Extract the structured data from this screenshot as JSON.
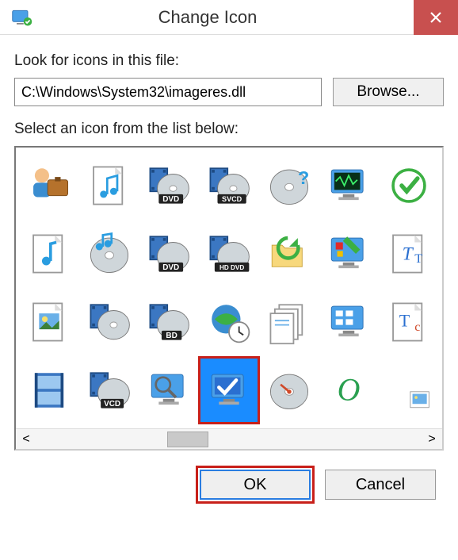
{
  "titlebar": {
    "title": "Change Icon"
  },
  "labels": {
    "look_for": "Look for icons in this file:",
    "select": "Select an icon from the list below:"
  },
  "path_field": {
    "value": "C:\\Windows\\System32\\imageres.dll"
  },
  "buttons": {
    "browse": "Browse...",
    "ok": "OK",
    "cancel": "Cancel"
  },
  "scrollbar": {
    "left": "<",
    "right": ">"
  },
  "icons": [
    {
      "name": "user-briefcase-icon",
      "selected": false
    },
    {
      "name": "page-music-icon",
      "selected": false
    },
    {
      "name": "disc-dvd-film-icon",
      "selected": false
    },
    {
      "name": "disc-svcd-film-icon",
      "selected": false
    },
    {
      "name": "disc-question-icon",
      "selected": false
    },
    {
      "name": "monitor-waveform-icon",
      "selected": false
    },
    {
      "name": "checkmark-green-icon",
      "selected": false
    },
    {
      "name": "page-note-icon",
      "selected": false
    },
    {
      "name": "disc-music-icon",
      "selected": false
    },
    {
      "name": "disc-dvd-film2-icon",
      "selected": false
    },
    {
      "name": "disc-hddvd-icon",
      "selected": false
    },
    {
      "name": "folder-refresh-icon",
      "selected": false
    },
    {
      "name": "monitor-paint-icon",
      "selected": false
    },
    {
      "name": "page-tt-icon",
      "selected": false
    },
    {
      "name": "page-photo-icon",
      "selected": false
    },
    {
      "name": "disc-film-icon",
      "selected": false
    },
    {
      "name": "disc-bd-film-icon",
      "selected": false
    },
    {
      "name": "globe-clock-icon",
      "selected": false
    },
    {
      "name": "documents-stack-icon",
      "selected": false
    },
    {
      "name": "monitor-apps-icon",
      "selected": false
    },
    {
      "name": "page-tc-icon",
      "selected": false
    },
    {
      "name": "film-strip-icon",
      "selected": false
    },
    {
      "name": "disc-vcd-icon",
      "selected": false
    },
    {
      "name": "monitor-magnify-icon",
      "selected": false
    },
    {
      "name": "monitor-check-icon",
      "selected": true
    },
    {
      "name": "disc-gauge-icon",
      "selected": false
    },
    {
      "name": "letter-o-icon",
      "selected": false
    },
    {
      "name": "photo-small-icon",
      "selected": false
    }
  ]
}
